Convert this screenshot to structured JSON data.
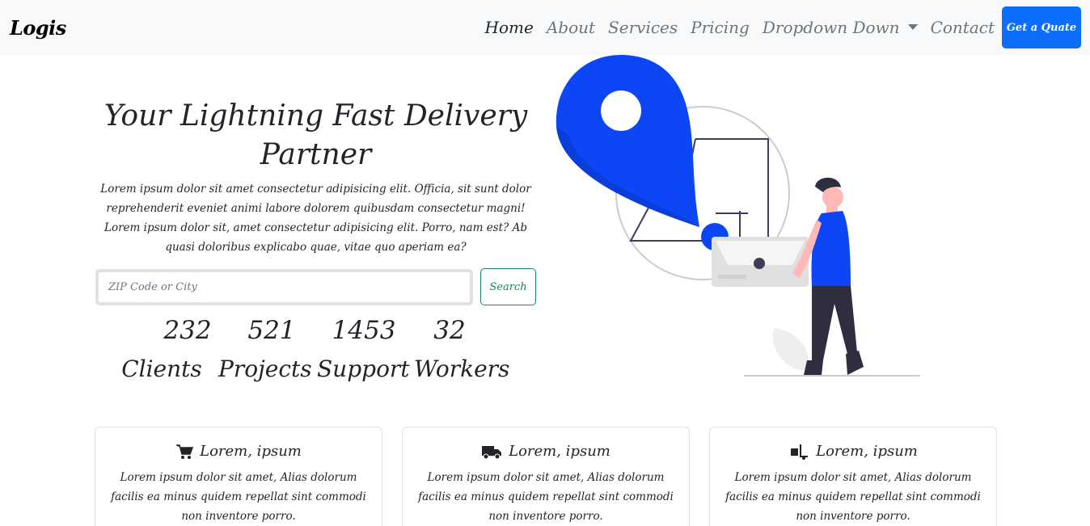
{
  "navbar": {
    "brand": "Logis",
    "links": [
      {
        "label": "Home",
        "active": true
      },
      {
        "label": "About"
      },
      {
        "label": "Services"
      },
      {
        "label": "Pricing"
      },
      {
        "label": "Dropdown Down"
      },
      {
        "label": "Contact"
      }
    ],
    "cta_label": "Get a Quate",
    "cta_color": "#0d6efd"
  },
  "hero": {
    "title": "Your Lightning Fast Delivery Partner",
    "text": "Lorem ipsum dolor sit amet consectetur adipisicing elit. Officia, sit sunt dolor reprehenderit eveniet animi labore dolorem quibusdam consectetur magni! Lorem ipsum dolor sit, amet consectetur adipisicing elit. Porro, nam est? Ab quasi doloribus explicabo quae, vitae quo aperiam ea?",
    "search": {
      "placeholder": "ZIP Code or City",
      "button_label": "Search",
      "button_color": "#198754"
    }
  },
  "stats": [
    {
      "number": "232",
      "label": "Clients"
    },
    {
      "number": "521",
      "label": "Projects"
    },
    {
      "number": "1453",
      "label": "Support"
    },
    {
      "number": "32",
      "label": "Workers"
    }
  ],
  "illustration": {
    "accent": "#0d47f5",
    "icon": "delivery-person-location-illustration"
  },
  "cards": [
    {
      "icon": "cart-icon",
      "title": "Lorem, ipsum",
      "text": "Lorem ipsum dolor sit amet, Alias dolorum facilis ea minus quidem repellat sint commodi non inventore porro."
    },
    {
      "icon": "truck-icon",
      "title": "Lorem, ipsum",
      "text": "Lorem ipsum dolor sit amet, Alias dolorum facilis ea minus quidem repellat sint commodi non inventore porro."
    },
    {
      "icon": "dolly-icon",
      "title": "Lorem, ipsum",
      "text": "Lorem ipsum dolor sit amet, Alias dolorum facilis ea minus quidem repellat sint commodi non inventore porro."
    }
  ]
}
